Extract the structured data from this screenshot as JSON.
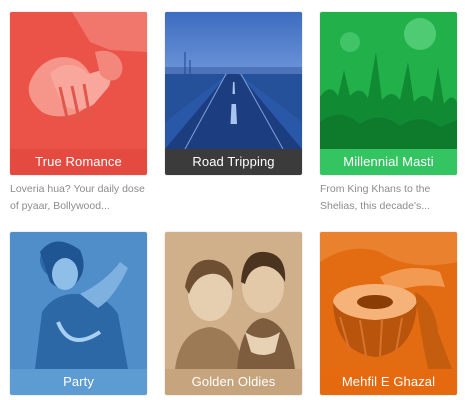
{
  "playlists": [
    {
      "title": "True Romance",
      "description": "Loveria hua? Your daily dose of pyaar, Bollywood...",
      "image_icon": "holding-hands-icon",
      "tint_color": "#e8473f",
      "label_color": "#e44a40"
    },
    {
      "title": "Road Tripping",
      "description": "",
      "image_icon": "highway-icon",
      "tint_color": "#2a58a8",
      "label_color": "#3b3b3b"
    },
    {
      "title": "Millennial Masti",
      "description": "From King Khans to the Shelias, this decade's...",
      "image_icon": "concert-crowd-icon",
      "tint_color": "#22b04a",
      "label_color": "#34c562"
    },
    {
      "title": "Party",
      "description": "",
      "image_icon": "dancer-icon",
      "tint_color": "#4f8ec9",
      "label_color": "#5c9cd2"
    },
    {
      "title": "Golden Oldies",
      "description": "",
      "image_icon": "vintage-portrait-icon",
      "tint_color": "#c9a57c",
      "label_color": "#c5a47e"
    },
    {
      "title": "Mehfil E Ghazal",
      "description": "",
      "image_icon": "tabla-drum-icon",
      "tint_color": "#e36c12",
      "label_color": "#e5690f"
    }
  ]
}
